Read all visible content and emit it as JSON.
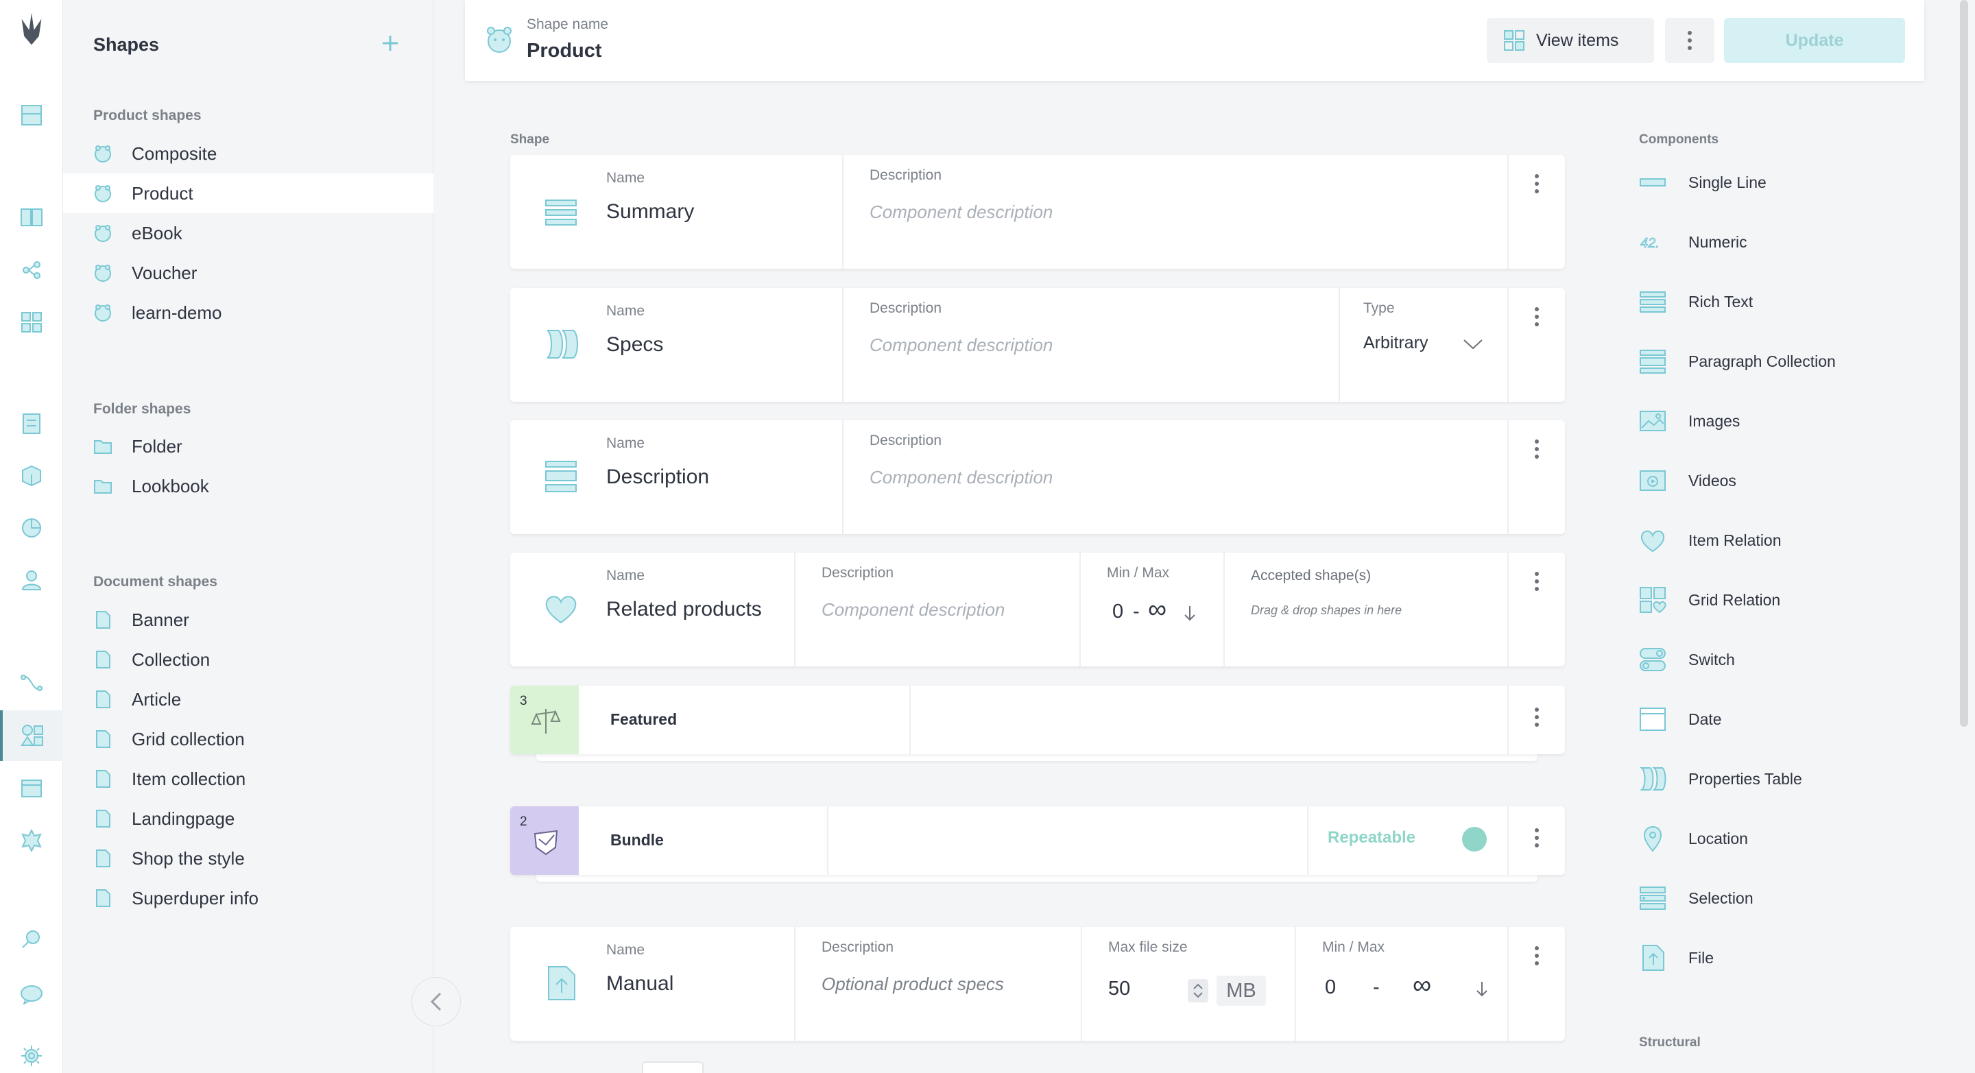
{
  "sidebar": {
    "title": "Shapes",
    "groups": [
      {
        "title": "Product shapes",
        "items": [
          "Composite",
          "Product",
          "eBook",
          "Voucher",
          "learn-demo"
        ]
      },
      {
        "title": "Folder shapes",
        "items": [
          "Folder",
          "Lookbook"
        ]
      },
      {
        "title": "Document shapes",
        "items": [
          "Banner",
          "Collection",
          "Article",
          "Grid collection",
          "Item collection",
          "Landingpage",
          "Shop the style",
          "Superduper info"
        ]
      }
    ],
    "active_item": "Product"
  },
  "header": {
    "label": "Shape name",
    "name": "Product",
    "view_items": "View items",
    "update": "Update"
  },
  "main": {
    "section_label": "Shape",
    "cards": [
      {
        "name_label": "Name",
        "name": "Summary",
        "desc_label": "Description",
        "desc_placeholder": "Component description"
      },
      {
        "name_label": "Name",
        "name": "Specs",
        "desc_label": "Description",
        "desc_placeholder": "Component description",
        "type_label": "Type",
        "type_value": "Arbitrary"
      },
      {
        "name_label": "Name",
        "name": "Description",
        "desc_label": "Description",
        "desc_placeholder": "Component description"
      },
      {
        "name_label": "Name",
        "name": "Related products",
        "desc_label": "Description",
        "desc_placeholder": "Component description",
        "minmax_label": "Min / Max",
        "min": "0",
        "sep": "-",
        "max": "∞",
        "accepted_label": "Accepted shape(s)",
        "accepted_hint": "Drag & drop shapes in here"
      },
      {
        "name_label": "Name",
        "name": "Manual",
        "desc_label": "Description",
        "desc_value": "Optional product specs",
        "filesize_label": "Max file size",
        "filesize": "50",
        "unit": "MB",
        "minmax_label": "Min / Max",
        "min": "0",
        "sep": "-",
        "max": "∞"
      }
    ],
    "structurals": [
      {
        "count": "3",
        "name": "Featured"
      },
      {
        "count": "2",
        "name": "Bundle",
        "repeatable": "Repeatable"
      }
    ]
  },
  "components": {
    "label": "Components",
    "items": [
      "Single Line",
      "Numeric",
      "Rich Text",
      "Paragraph Collection",
      "Images",
      "Videos",
      "Item Relation",
      "Grid Relation",
      "Switch",
      "Date",
      "Properties Table",
      "Location",
      "Selection",
      "File"
    ],
    "structural_label": "Structural"
  },
  "colors": {
    "accent": "#7ac8d4",
    "featured_badge": "#d9f3d4",
    "bundle_badge": "#d4cbf0",
    "update_bg": "#d6f1f3"
  }
}
